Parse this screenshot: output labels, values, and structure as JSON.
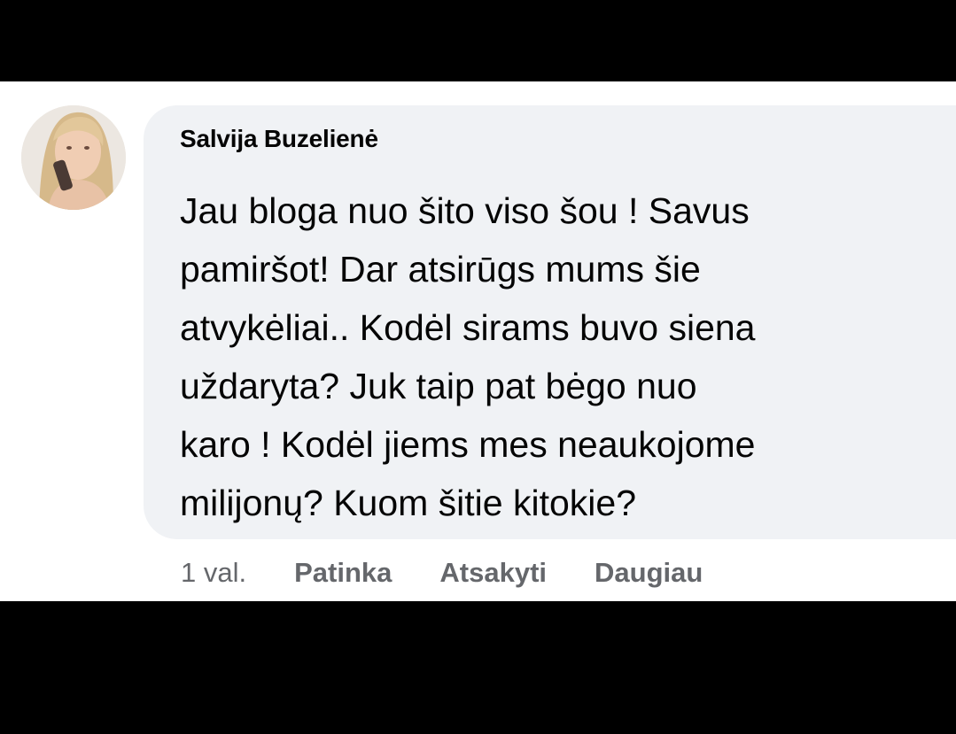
{
  "comment": {
    "author": "Salvija Buzelienė",
    "lines": [
      "Jau bloga nuo šito viso šou ! Savus",
      "pamiršot! Dar atsirūgs mums šie",
      "atvykėliai.. Kodėl sirams buvo siena",
      "uždaryta? Juk taip pat bėgo nuo",
      "karo ! Kodėl jiems mes neaukojome",
      "milijonų? Kuom šitie kitokie?"
    ],
    "time": "1 val.",
    "actions": {
      "like": "Patinka",
      "reply": "Atsakyti",
      "more": "Daugiau"
    }
  },
  "colors": {
    "bubble_background": "#f0f2f5",
    "action_text": "#65676b",
    "primary_text": "#050505"
  }
}
